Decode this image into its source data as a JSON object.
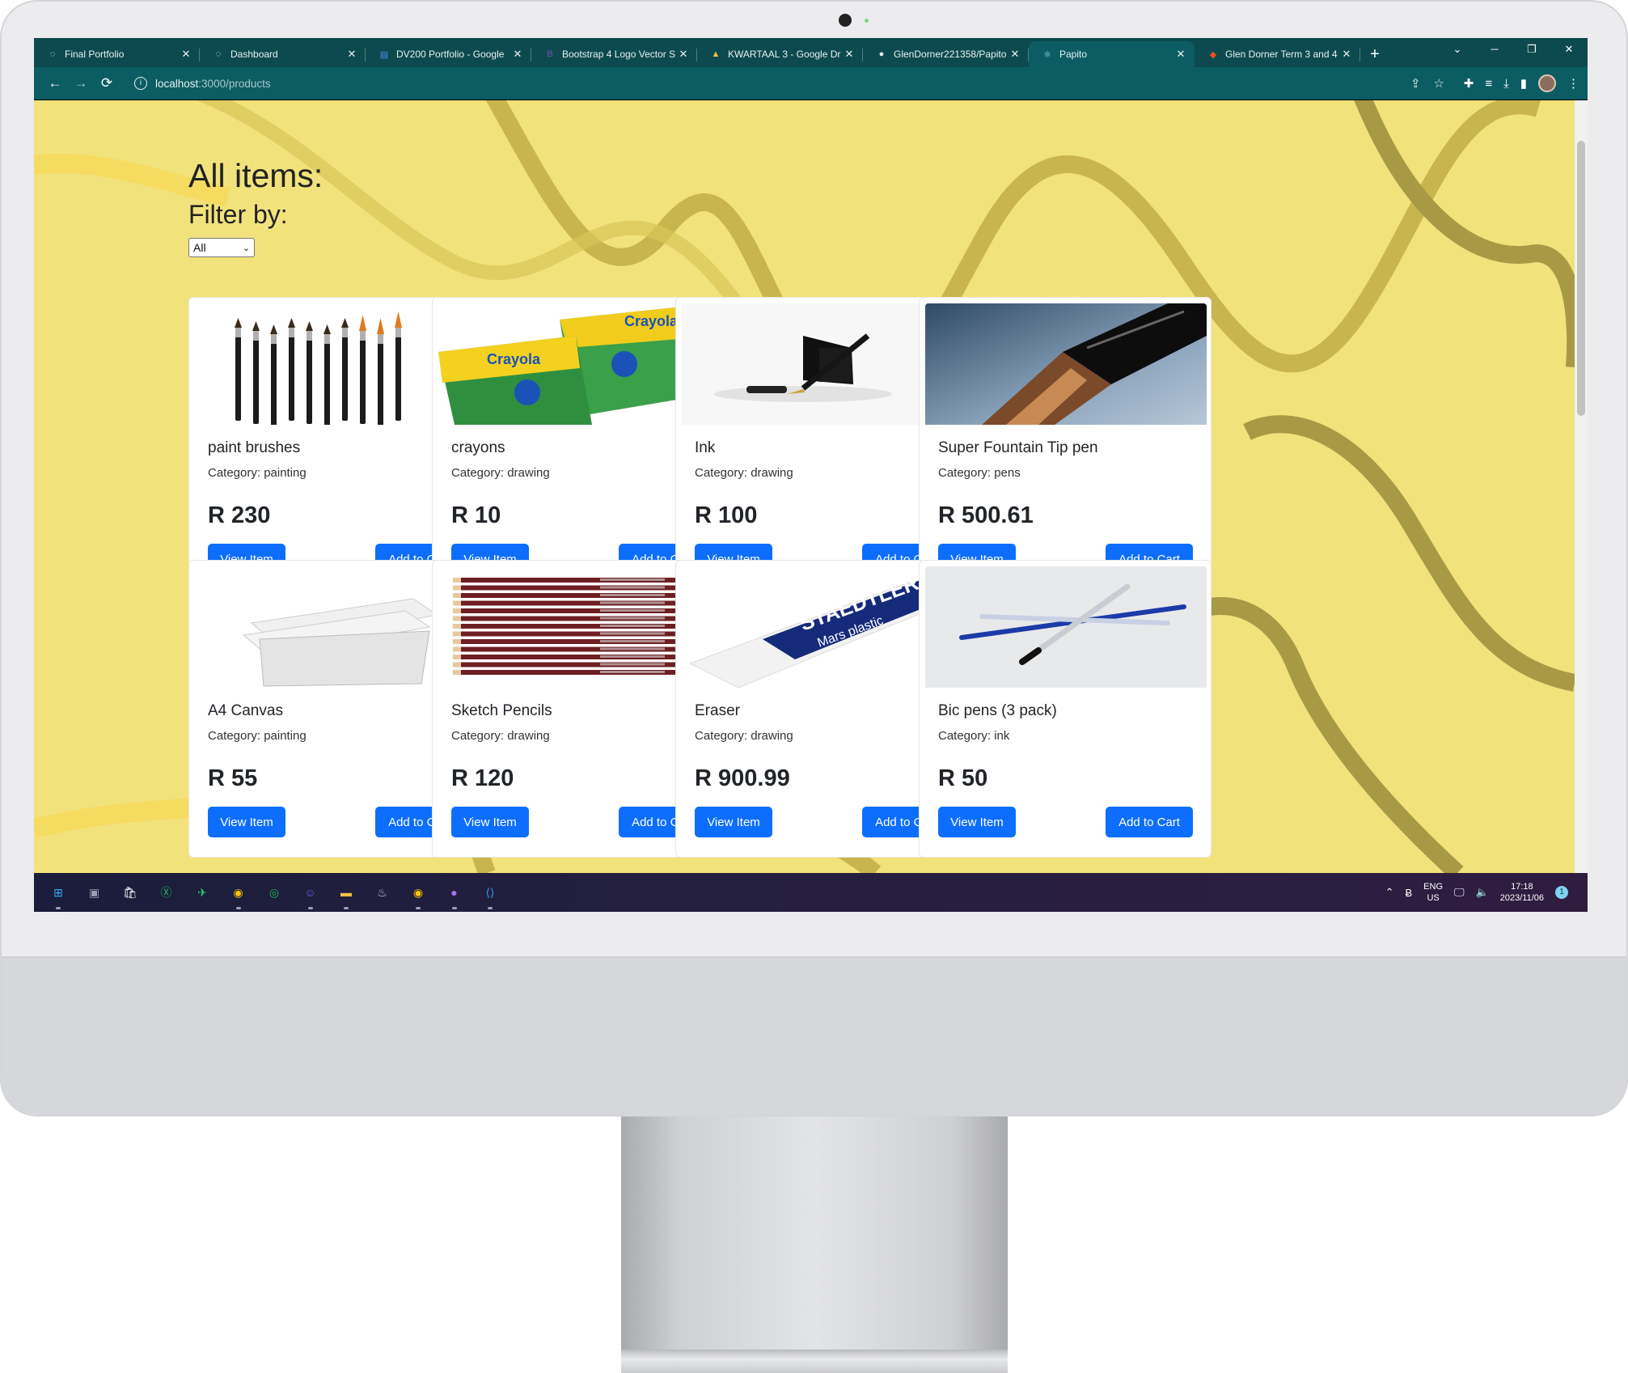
{
  "browser": {
    "tabs": [
      {
        "title": "Final Portfolio",
        "icon": "globe-icon",
        "active": false
      },
      {
        "title": "Dashboard",
        "icon": "globe-icon",
        "active": false
      },
      {
        "title": "DV200 Portfolio - Google",
        "icon": "google-docs-icon",
        "active": false
      },
      {
        "title": "Bootstrap 4 Logo Vector S",
        "icon": "bootstrap-icon",
        "active": false
      },
      {
        "title": "KWARTAAL 3 - Google Dr",
        "icon": "google-drive-icon",
        "active": false
      },
      {
        "title": "GlenDorner221358/Papito",
        "icon": "github-icon",
        "active": false
      },
      {
        "title": "Papito",
        "icon": "react-icon",
        "active": true
      },
      {
        "title": "Glen Dorner Term 3 and 4",
        "icon": "figma-icon",
        "active": false
      }
    ],
    "url_host": "localhost",
    "url_path": ":3000/products",
    "accent": "#0b5d63"
  },
  "page": {
    "heading": "All items:",
    "filter_label": "Filter by:",
    "filter_selected": "All",
    "background": "#f2e27c"
  },
  "products": [
    {
      "name": "paint brushes",
      "category": "Category: painting",
      "price": "R 230",
      "image": "paint-brushes-image"
    },
    {
      "name": "crayons",
      "category": "Category: drawing",
      "price": "R 10",
      "image": "crayons-image"
    },
    {
      "name": "Ink",
      "category": "Category: drawing",
      "price": "R 100",
      "image": "ink-pen-image"
    },
    {
      "name": "Super Fountain Tip pen",
      "category": "Category: pens",
      "price": "R 500.61",
      "image": "fountain-pen-image"
    },
    {
      "name": "A4 Canvas",
      "category": "Category: painting",
      "price": "R 55",
      "image": "canvas-image"
    },
    {
      "name": "Sketch Pencils",
      "category": "Category: drawing",
      "price": "R 120",
      "image": "pencils-image"
    },
    {
      "name": "Eraser",
      "category": "Category: drawing",
      "price": "R 900.99",
      "image": "eraser-image"
    },
    {
      "name": "Bic pens (3 pack)",
      "category": "Category: ink",
      "price": "R 50",
      "image": "bic-pens-image"
    }
  ],
  "buttons": {
    "view": "View Item",
    "cart": "Add to Cart",
    "color": "#0d6efd"
  },
  "eraser_brand": "STAEDTLER",
  "eraser_model": "Mars plastic",
  "taskbar": {
    "lang_top": "ENG",
    "lang_bottom": "US",
    "time": "17:18",
    "date": "2023/11/06",
    "notifications": "1"
  }
}
